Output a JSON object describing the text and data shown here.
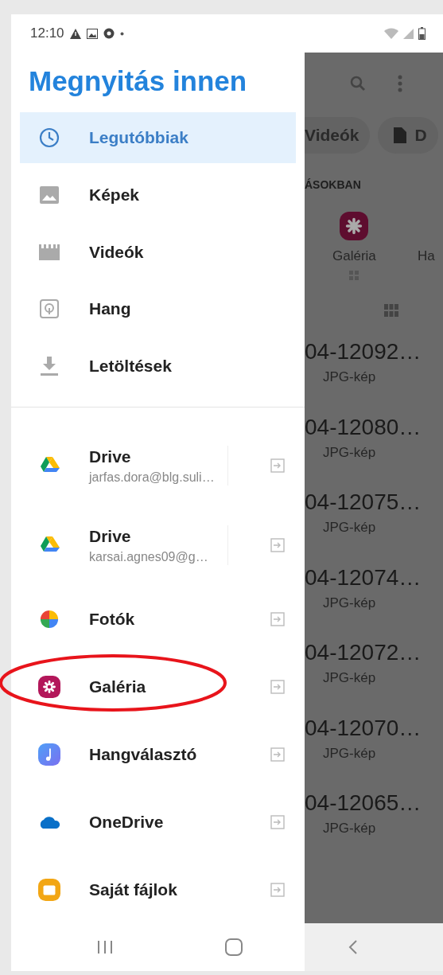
{
  "status_bar": {
    "time": "12:10"
  },
  "drawer": {
    "title": "Megnyitás innen",
    "locations": [
      {
        "label": "Legutóbbiak",
        "selected": true
      },
      {
        "label": "Képek",
        "selected": false
      },
      {
        "label": "Videók",
        "selected": false
      },
      {
        "label": "Hang",
        "selected": false
      },
      {
        "label": "Letöltések",
        "selected": false
      }
    ],
    "apps": [
      {
        "label": "Drive",
        "account": "jarfas.dora@blg.suli…",
        "selected": false,
        "circled": false
      },
      {
        "label": "Drive",
        "account": "karsai.agnes09@g…",
        "selected": false,
        "circled": false
      },
      {
        "label": "Fotók",
        "selected": false,
        "circled": false
      },
      {
        "label": "Galéria",
        "selected": false,
        "circled": true
      },
      {
        "label": "Hangválasztó",
        "selected": false,
        "circled": false
      },
      {
        "label": "OneDrive",
        "selected": false,
        "circled": false
      },
      {
        "label": "Saját fájlok",
        "selected": false,
        "circled": false
      }
    ]
  },
  "background": {
    "chips": [
      "Videók",
      "D"
    ],
    "section_header": "ÁSOKBAN",
    "apps": [
      {
        "label": "Galéria"
      },
      {
        "label": "Ha"
      }
    ],
    "files": [
      {
        "name": "04-12092…",
        "type": "JPG-kép"
      },
      {
        "name": "04-12080…",
        "type": "JPG-kép"
      },
      {
        "name": "04-12075…",
        "type": "JPG-kép"
      },
      {
        "name": "04-12074…",
        "type": "JPG-kép"
      },
      {
        "name": "04-12072…",
        "type": "JPG-kép"
      },
      {
        "name": "04-12070…",
        "type": "JPG-kép"
      },
      {
        "name": "04-12065…",
        "type": "JPG-kép"
      }
    ]
  }
}
